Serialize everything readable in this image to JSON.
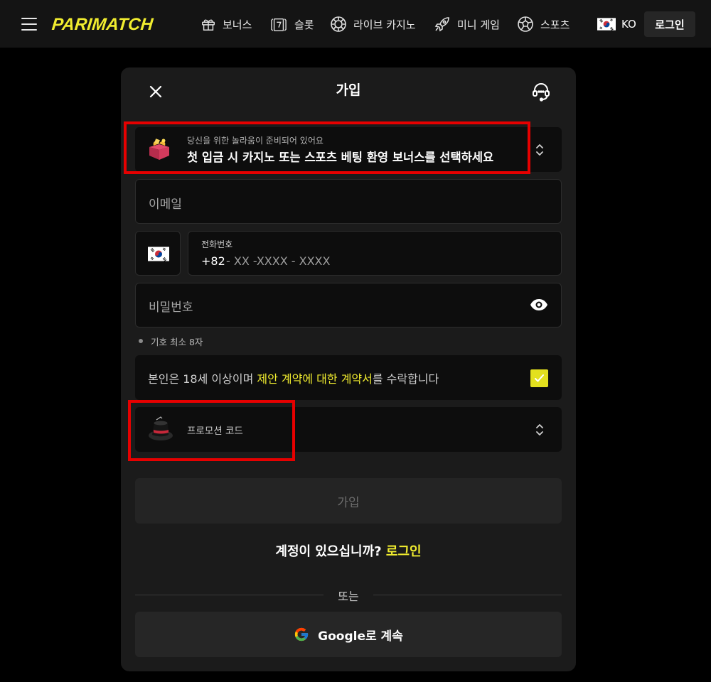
{
  "header": {
    "logo": "PARIMATCH",
    "nav": [
      {
        "label": "보너스",
        "icon": "gift-icon"
      },
      {
        "label": "슬롯",
        "icon": "slot-icon"
      },
      {
        "label": "라이브 카지노",
        "icon": "casino-chip-icon"
      },
      {
        "label": "미니 게임",
        "icon": "rocket-icon"
      },
      {
        "label": "스포츠",
        "icon": "soccer-ball-icon"
      }
    ],
    "language": "KO",
    "login": "로그인"
  },
  "modal": {
    "title": "가입",
    "bonus": {
      "subtitle": "당신을 위한 놀라움이 준비되어 있어요",
      "text": "첫 입금 시 카지노 또는 스포츠 베팅 환영 보너스를 선택하세요"
    },
    "email_placeholder": "이메일",
    "phone": {
      "label": "전화번호",
      "country_code": "+82",
      "mask": "- XX -XXXX - XXXX"
    },
    "password_placeholder": "비밀번호",
    "password_hint": "기호 최소 8자",
    "terms": {
      "before": "본인은 18세 이상이며 ",
      "link": "제안 계약에 대한 계약서",
      "after": "를 수락합니다",
      "checked": true
    },
    "promo_label": "프로모션 코드",
    "submit": "가입",
    "have_account": "계정이 있으십니까?",
    "login_link": "로그인",
    "or": "또는",
    "google": "Google로 계속"
  },
  "colors": {
    "brand_yellow": "#f0ec2f",
    "highlight_red": "#e60000",
    "background": "#000000",
    "panel": "#1b1b1b"
  }
}
